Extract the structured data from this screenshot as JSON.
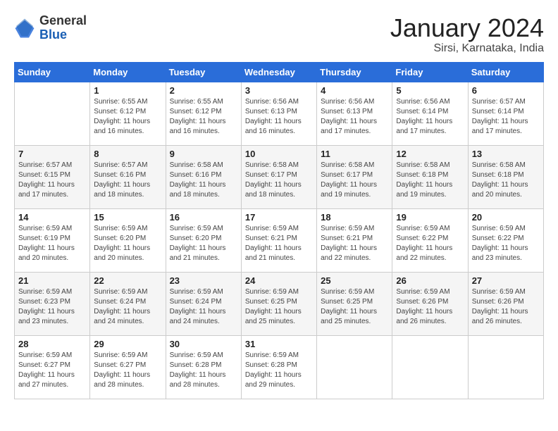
{
  "logo": {
    "general": "General",
    "blue": "Blue"
  },
  "title": "January 2024",
  "location": "Sirsi, Karnataka, India",
  "weekdays": [
    "Sunday",
    "Monday",
    "Tuesday",
    "Wednesday",
    "Thursday",
    "Friday",
    "Saturday"
  ],
  "weeks": [
    [
      {
        "day": "",
        "sunrise": "",
        "sunset": "",
        "daylight": ""
      },
      {
        "day": "1",
        "sunrise": "Sunrise: 6:55 AM",
        "sunset": "Sunset: 6:12 PM",
        "daylight": "Daylight: 11 hours and 16 minutes."
      },
      {
        "day": "2",
        "sunrise": "Sunrise: 6:55 AM",
        "sunset": "Sunset: 6:12 PM",
        "daylight": "Daylight: 11 hours and 16 minutes."
      },
      {
        "day": "3",
        "sunrise": "Sunrise: 6:56 AM",
        "sunset": "Sunset: 6:13 PM",
        "daylight": "Daylight: 11 hours and 16 minutes."
      },
      {
        "day": "4",
        "sunrise": "Sunrise: 6:56 AM",
        "sunset": "Sunset: 6:13 PM",
        "daylight": "Daylight: 11 hours and 17 minutes."
      },
      {
        "day": "5",
        "sunrise": "Sunrise: 6:56 AM",
        "sunset": "Sunset: 6:14 PM",
        "daylight": "Daylight: 11 hours and 17 minutes."
      },
      {
        "day": "6",
        "sunrise": "Sunrise: 6:57 AM",
        "sunset": "Sunset: 6:14 PM",
        "daylight": "Daylight: 11 hours and 17 minutes."
      }
    ],
    [
      {
        "day": "7",
        "sunrise": "Sunrise: 6:57 AM",
        "sunset": "Sunset: 6:15 PM",
        "daylight": "Daylight: 11 hours and 17 minutes."
      },
      {
        "day": "8",
        "sunrise": "Sunrise: 6:57 AM",
        "sunset": "Sunset: 6:16 PM",
        "daylight": "Daylight: 11 hours and 18 minutes."
      },
      {
        "day": "9",
        "sunrise": "Sunrise: 6:58 AM",
        "sunset": "Sunset: 6:16 PM",
        "daylight": "Daylight: 11 hours and 18 minutes."
      },
      {
        "day": "10",
        "sunrise": "Sunrise: 6:58 AM",
        "sunset": "Sunset: 6:17 PM",
        "daylight": "Daylight: 11 hours and 18 minutes."
      },
      {
        "day": "11",
        "sunrise": "Sunrise: 6:58 AM",
        "sunset": "Sunset: 6:17 PM",
        "daylight": "Daylight: 11 hours and 19 minutes."
      },
      {
        "day": "12",
        "sunrise": "Sunrise: 6:58 AM",
        "sunset": "Sunset: 6:18 PM",
        "daylight": "Daylight: 11 hours and 19 minutes."
      },
      {
        "day": "13",
        "sunrise": "Sunrise: 6:58 AM",
        "sunset": "Sunset: 6:18 PM",
        "daylight": "Daylight: 11 hours and 20 minutes."
      }
    ],
    [
      {
        "day": "14",
        "sunrise": "Sunrise: 6:59 AM",
        "sunset": "Sunset: 6:19 PM",
        "daylight": "Daylight: 11 hours and 20 minutes."
      },
      {
        "day": "15",
        "sunrise": "Sunrise: 6:59 AM",
        "sunset": "Sunset: 6:20 PM",
        "daylight": "Daylight: 11 hours and 20 minutes."
      },
      {
        "day": "16",
        "sunrise": "Sunrise: 6:59 AM",
        "sunset": "Sunset: 6:20 PM",
        "daylight": "Daylight: 11 hours and 21 minutes."
      },
      {
        "day": "17",
        "sunrise": "Sunrise: 6:59 AM",
        "sunset": "Sunset: 6:21 PM",
        "daylight": "Daylight: 11 hours and 21 minutes."
      },
      {
        "day": "18",
        "sunrise": "Sunrise: 6:59 AM",
        "sunset": "Sunset: 6:21 PM",
        "daylight": "Daylight: 11 hours and 22 minutes."
      },
      {
        "day": "19",
        "sunrise": "Sunrise: 6:59 AM",
        "sunset": "Sunset: 6:22 PM",
        "daylight": "Daylight: 11 hours and 22 minutes."
      },
      {
        "day": "20",
        "sunrise": "Sunrise: 6:59 AM",
        "sunset": "Sunset: 6:22 PM",
        "daylight": "Daylight: 11 hours and 23 minutes."
      }
    ],
    [
      {
        "day": "21",
        "sunrise": "Sunrise: 6:59 AM",
        "sunset": "Sunset: 6:23 PM",
        "daylight": "Daylight: 11 hours and 23 minutes."
      },
      {
        "day": "22",
        "sunrise": "Sunrise: 6:59 AM",
        "sunset": "Sunset: 6:24 PM",
        "daylight": "Daylight: 11 hours and 24 minutes."
      },
      {
        "day": "23",
        "sunrise": "Sunrise: 6:59 AM",
        "sunset": "Sunset: 6:24 PM",
        "daylight": "Daylight: 11 hours and 24 minutes."
      },
      {
        "day": "24",
        "sunrise": "Sunrise: 6:59 AM",
        "sunset": "Sunset: 6:25 PM",
        "daylight": "Daylight: 11 hours and 25 minutes."
      },
      {
        "day": "25",
        "sunrise": "Sunrise: 6:59 AM",
        "sunset": "Sunset: 6:25 PM",
        "daylight": "Daylight: 11 hours and 25 minutes."
      },
      {
        "day": "26",
        "sunrise": "Sunrise: 6:59 AM",
        "sunset": "Sunset: 6:26 PM",
        "daylight": "Daylight: 11 hours and 26 minutes."
      },
      {
        "day": "27",
        "sunrise": "Sunrise: 6:59 AM",
        "sunset": "Sunset: 6:26 PM",
        "daylight": "Daylight: 11 hours and 26 minutes."
      }
    ],
    [
      {
        "day": "28",
        "sunrise": "Sunrise: 6:59 AM",
        "sunset": "Sunset: 6:27 PM",
        "daylight": "Daylight: 11 hours and 27 minutes."
      },
      {
        "day": "29",
        "sunrise": "Sunrise: 6:59 AM",
        "sunset": "Sunset: 6:27 PM",
        "daylight": "Daylight: 11 hours and 28 minutes."
      },
      {
        "day": "30",
        "sunrise": "Sunrise: 6:59 AM",
        "sunset": "Sunset: 6:28 PM",
        "daylight": "Daylight: 11 hours and 28 minutes."
      },
      {
        "day": "31",
        "sunrise": "Sunrise: 6:59 AM",
        "sunset": "Sunset: 6:28 PM",
        "daylight": "Daylight: 11 hours and 29 minutes."
      },
      {
        "day": "",
        "sunrise": "",
        "sunset": "",
        "daylight": ""
      },
      {
        "day": "",
        "sunrise": "",
        "sunset": "",
        "daylight": ""
      },
      {
        "day": "",
        "sunrise": "",
        "sunset": "",
        "daylight": ""
      }
    ]
  ]
}
